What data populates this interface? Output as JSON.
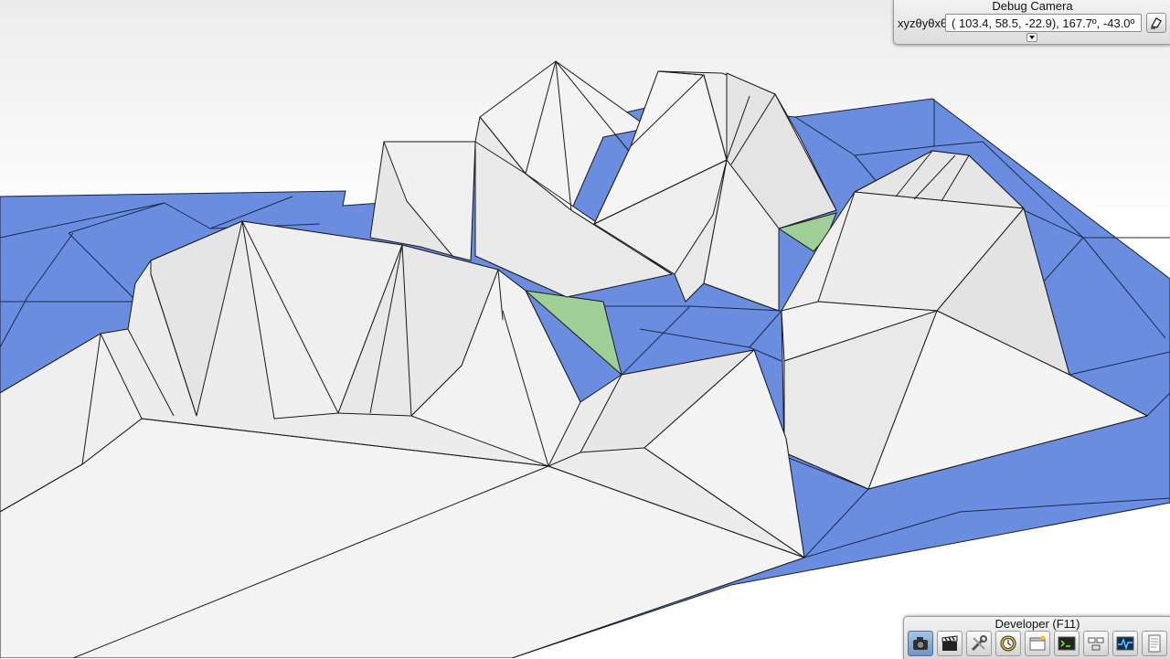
{
  "debug_camera": {
    "title": "Debug Camera",
    "field_label": "xyzθyθxθz",
    "field_value": "( 103.4,  58.5, -22.9),  167.7º, -43.0º",
    "copy_icon": "copy-icon",
    "expand_icon": "chevron-down-icon"
  },
  "developer": {
    "title": "Developer (F11)",
    "buttons": [
      {
        "icon": "camera-icon",
        "active": true
      },
      {
        "icon": "clapperboard-icon",
        "active": false
      },
      {
        "icon": "tools-icon",
        "active": false
      },
      {
        "icon": "clock-icon",
        "active": false
      },
      {
        "icon": "new-window-icon",
        "active": false
      },
      {
        "icon": "terminal-icon",
        "active": false
      },
      {
        "icon": "network-icon",
        "active": false
      },
      {
        "icon": "activity-monitor-icon",
        "active": false
      },
      {
        "icon": "document-icon",
        "active": false
      }
    ]
  },
  "colors": {
    "ground_blue": "#6a8de0",
    "terrain_white": "#eeeeee",
    "highlight_green": "#9fcf96",
    "edge": "#1a1a1a"
  }
}
